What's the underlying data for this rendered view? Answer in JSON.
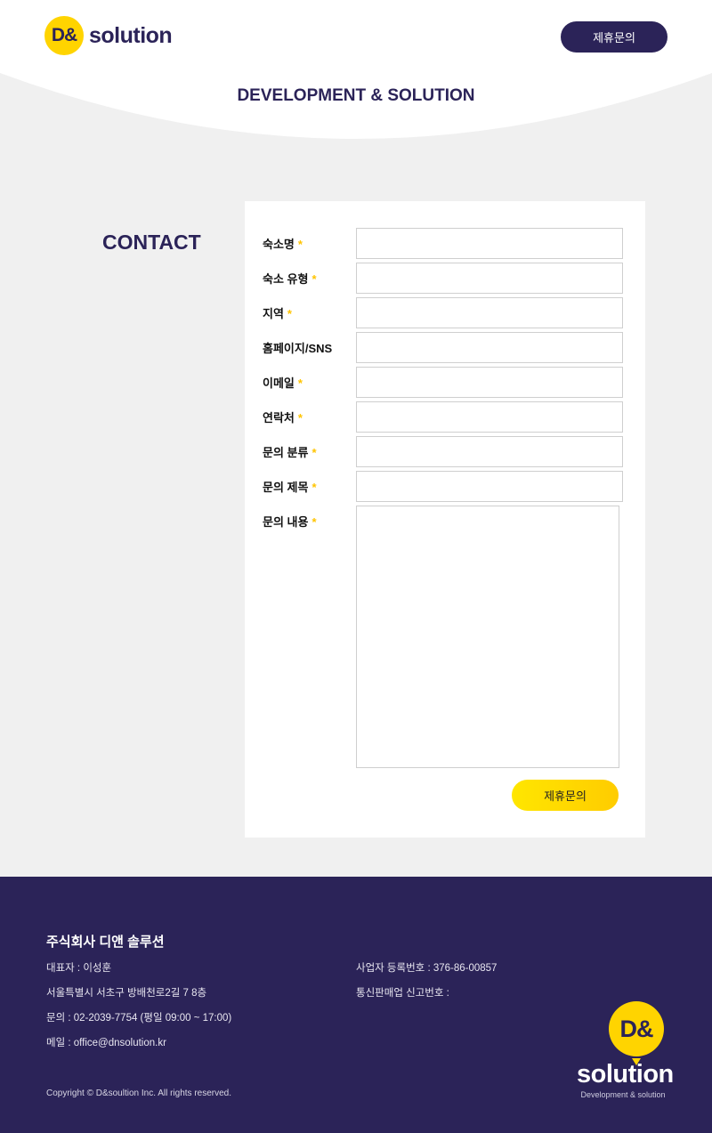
{
  "header": {
    "logo_mark": "D&",
    "logo_word": "solution",
    "cta_label": "제휴문의",
    "tagline": "DEVELOPMENT & SOLUTION"
  },
  "contact": {
    "title": "CONTACT",
    "fields": [
      {
        "label": "숙소명",
        "required": true,
        "value": ""
      },
      {
        "label": "숙소 유형",
        "required": true,
        "value": ""
      },
      {
        "label": "지역",
        "required": true,
        "value": ""
      },
      {
        "label": "홈페이지/SNS",
        "required": false,
        "value": ""
      },
      {
        "label": "이메일",
        "required": true,
        "value": ""
      },
      {
        "label": "연락처",
        "required": true,
        "value": ""
      },
      {
        "label": "문의 분류",
        "required": true,
        "value": ""
      },
      {
        "label": "문의 제목",
        "required": true,
        "value": ""
      },
      {
        "label": "문의 내용",
        "required": true,
        "value": ""
      }
    ],
    "required_mark": "*",
    "submit_label": "제휴문의"
  },
  "footer": {
    "company": "주식회사 디앤 솔루션",
    "ceo": "대표자 : 이성훈",
    "address": "서울특별시 서초구 방배천로2길 7 8층",
    "phone": "문의 : 02-2039-7754 (평일 09:00 ~ 17:00)",
    "email": "메일 : office@dnsolution.kr",
    "business_no": "사업자 등록번호 : 376-86-00857",
    "ecommerce_no": "통신판매업 신고번호 :",
    "copyright": "Copyright © D&soultion Inc. All rights reserved.",
    "logo_mark": "D&",
    "logo_word": "solution",
    "logo_sub": "Development & solution"
  },
  "colors": {
    "brand_navy": "#2b2358",
    "brand_yellow": "#ffd400",
    "background": "#f0f0f0"
  }
}
